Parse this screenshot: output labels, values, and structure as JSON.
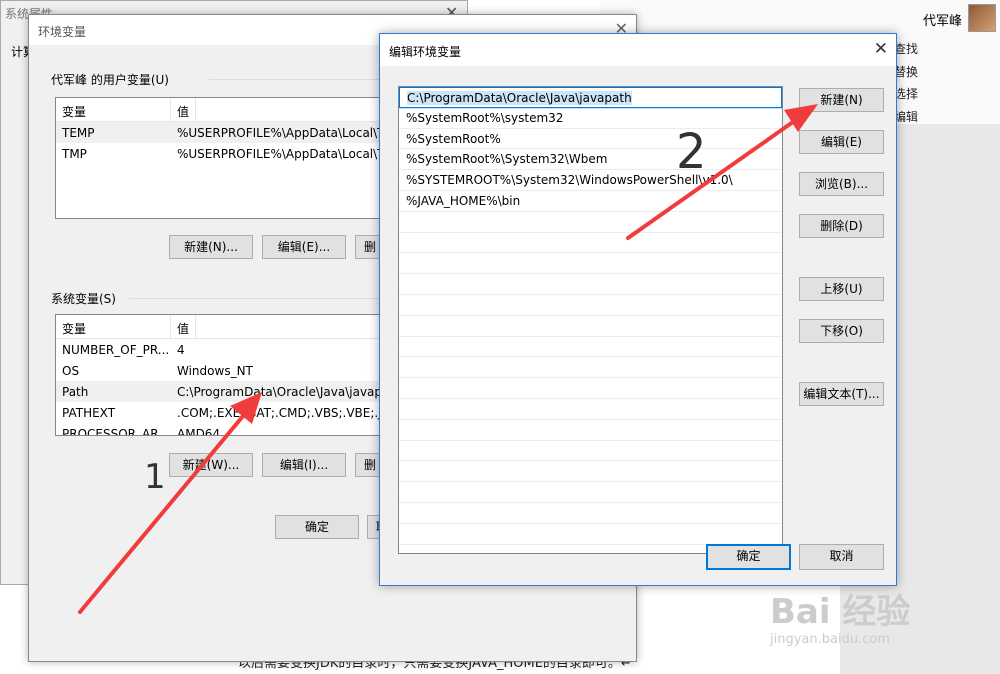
{
  "background": {
    "user_name": "代军峰",
    "commands": [
      "查找",
      "替换",
      "选择",
      "编辑"
    ],
    "doc_text": "以后需要变换JDK的目录时，只需要变换JAVA_HOME的目录即可。↵"
  },
  "system_properties": {
    "title": "系统属性",
    "tab": "计算"
  },
  "env_dialog": {
    "title": "环境变量",
    "user_group_label": "代军峰 的用户变量(U)",
    "user_headers": [
      "变量",
      "值"
    ],
    "user_rows": [
      {
        "name": "TEMP",
        "value": "%USERPROFILE%\\AppData\\Local\\Te"
      },
      {
        "name": "TMP",
        "value": "%USERPROFILE%\\AppData\\Local\\Te"
      }
    ],
    "user_buttons": {
      "new": "新建(N)...",
      "edit": "编辑(E)...",
      "delete": "删"
    },
    "system_group_label": "系统变量(S)",
    "system_headers": [
      "变量",
      "值"
    ],
    "system_rows": [
      {
        "name": "NUMBER_OF_PR...",
        "value": "4"
      },
      {
        "name": "OS",
        "value": "Windows_NT"
      },
      {
        "name": "Path",
        "value": "C:\\ProgramData\\Oracle\\Java\\javapa"
      },
      {
        "name": "PATHEXT",
        "value": ".COM;.EXE;.BAT;.CMD;.VBS;.VBE;.JS;."
      },
      {
        "name": "PROCESSOR_AR...",
        "value": "AMD64"
      }
    ],
    "system_buttons": {
      "new": "新建(W)...",
      "edit": "编辑(I)...",
      "delete": "删"
    },
    "ok": "确定",
    "cancel": "取"
  },
  "edit_dialog": {
    "title": "编辑环境变量",
    "paths": [
      "C:\\ProgramData\\Oracle\\Java\\javapath",
      "%SystemRoot%\\system32",
      "%SystemRoot%",
      "%SystemRoot%\\System32\\Wbem",
      "%SYSTEMROOT%\\System32\\WindowsPowerShell\\v1.0\\",
      "%JAVA_HOME%\\bin"
    ],
    "buttons": {
      "new": "新建(N)",
      "edit": "编辑(E)",
      "browse": "浏览(B)...",
      "delete": "删除(D)",
      "move_up": "上移(U)",
      "move_down": "下移(O)",
      "edit_text": "编辑文本(T)..."
    },
    "ok": "确定",
    "cancel": "取消"
  },
  "annotations": {
    "step1": "1",
    "step2": "2",
    "arrow_color": "#f03c3c"
  },
  "watermark": {
    "brand": "Bai 经验",
    "url": "jingyan.baidu.com"
  }
}
